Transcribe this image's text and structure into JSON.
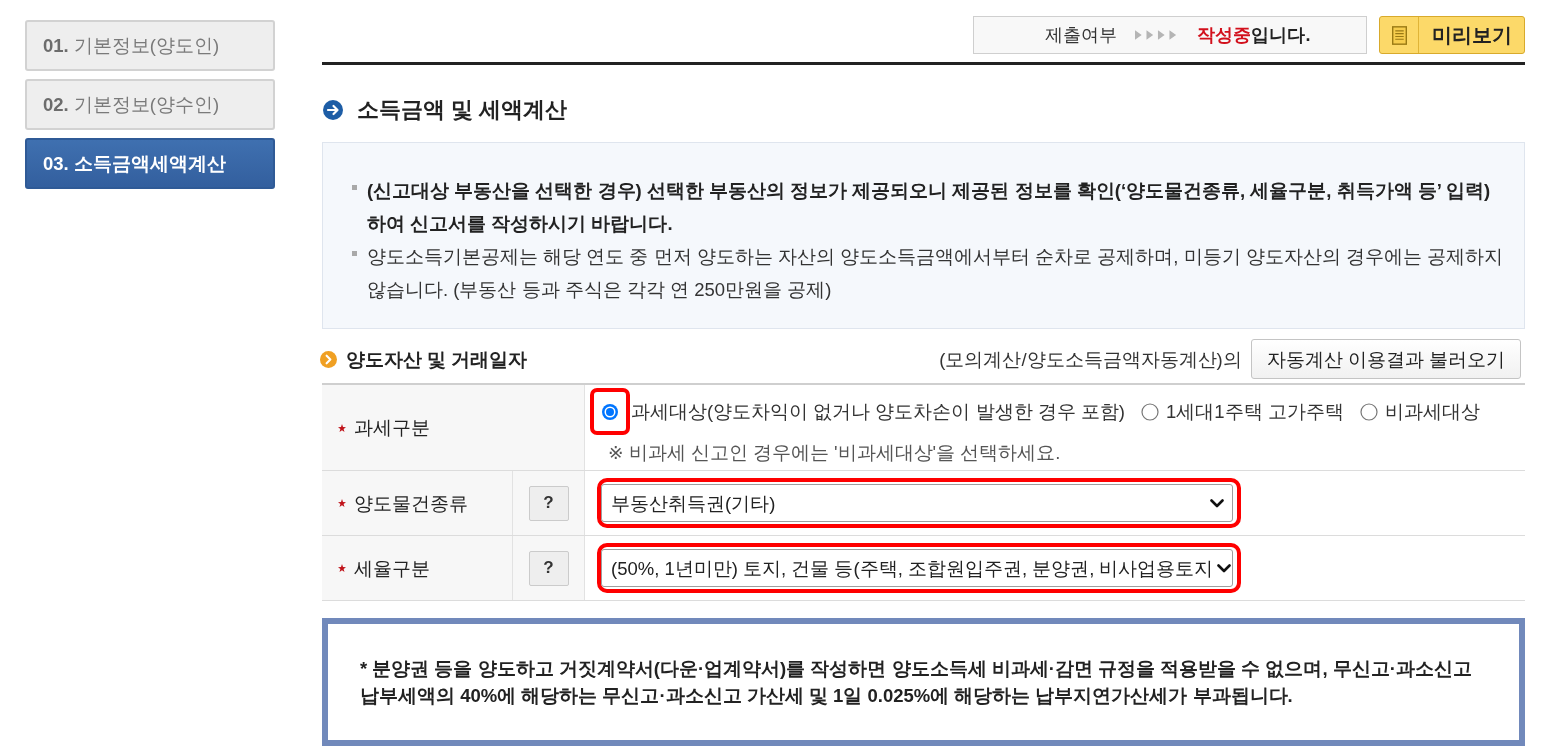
{
  "sidebar": {
    "items": [
      {
        "number": "01.",
        "label": "기본정보(양도인)",
        "selected": false
      },
      {
        "number": "02.",
        "label": "기본정보(양수인)",
        "selected": false
      },
      {
        "number": "03.",
        "label": "소득금액세액계산",
        "selected": true
      }
    ]
  },
  "status": {
    "label": "제출여부",
    "state": "작성중",
    "suffix": "입니다."
  },
  "preview_button": {
    "label": "미리보기"
  },
  "section": {
    "title": "소득금액 및 세액계산"
  },
  "notices": [
    {
      "text": "(신고대상 부동산을 선택한 경우) 선택한 부동산의 정보가 제공되오니 제공된 정보를 확인(‘양도물건종류, 세율구분, 취득가액 등’ 입력)하여 신고서를 작성하시기 바랍니다.",
      "emphasis": true
    },
    {
      "text": "양도소득기본공제는 해당 연도 중 먼저 양도하는 자산의 양도소득금액에서부터 순차로 공제하며, 미등기 양도자산의 경우에는 공제하지 않습니다. (부동산 등과 주식은 각각 연 250만원을 공제)",
      "emphasis": false
    }
  ],
  "subsection": {
    "title": "양도자산 및 거래일자",
    "lead": "(모의계산/양도소득금액자동계산)의",
    "button": "자동계산 이용결과 불러오기"
  },
  "form": {
    "rows": [
      {
        "kind": "radio",
        "label": "과세구분",
        "required": true,
        "options": [
          {
            "label": "과세대상(양도차익이 없거나 양도차손이 발생한 경우 포함)",
            "selected": true,
            "highlighted": true
          },
          {
            "label": "1세대1주택 고가주택",
            "selected": false,
            "highlighted": false
          },
          {
            "label": "비과세대상",
            "selected": false,
            "highlighted": false
          }
        ],
        "note": "※ 비과세 신고인 경우에는 '비과세대상'을 선택하세요."
      },
      {
        "kind": "select",
        "label": "양도물건종류",
        "required": true,
        "help": "?",
        "value": "부동산취득권(기타)",
        "highlighted": true
      },
      {
        "kind": "select",
        "label": "세율구분",
        "required": true,
        "help": "?",
        "value": "(50%, 1년미만) 토지, 건물 등(주택, 조합원입주권, 분양권, 비사업용토지",
        "highlighted": true
      }
    ]
  },
  "warning": {
    "text": "* 분양권 등을 양도하고 거짓계약서(다운·업계약서)를 작성하면 양도소득세 비과세·감면 규정을 적용받을 수 없으며, 무신고·과소신고 납부세액의 40%에 해당하는 무신고·과소신고 가산세 및 1일 0.025%에 해당하는 납부지연가산세가 부과됩니다."
  }
}
